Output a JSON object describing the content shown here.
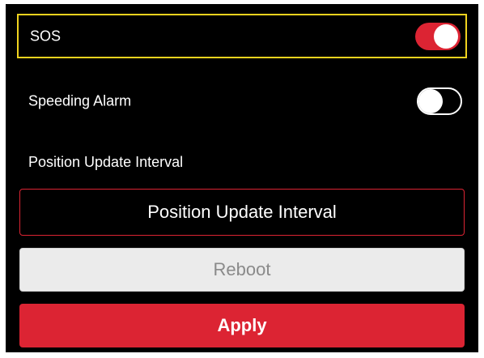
{
  "settings": {
    "sos": {
      "label": "SOS",
      "enabled": true
    },
    "speeding_alarm": {
      "label": "Speeding Alarm",
      "enabled": false
    },
    "position_update_interval": {
      "section_label": "Position Update Interval",
      "button_label": "Position Update Interval"
    }
  },
  "actions": {
    "reboot_label": "Reboot",
    "apply_label": "Apply"
  },
  "colors": {
    "accent": "#dc2433",
    "focus_outline": "#f0d21e",
    "background": "#000000",
    "disabled_button": "#ebebeb"
  },
  "icons": {
    "sos_toggle": "toggle-on-icon",
    "speeding_toggle": "toggle-off-icon"
  }
}
